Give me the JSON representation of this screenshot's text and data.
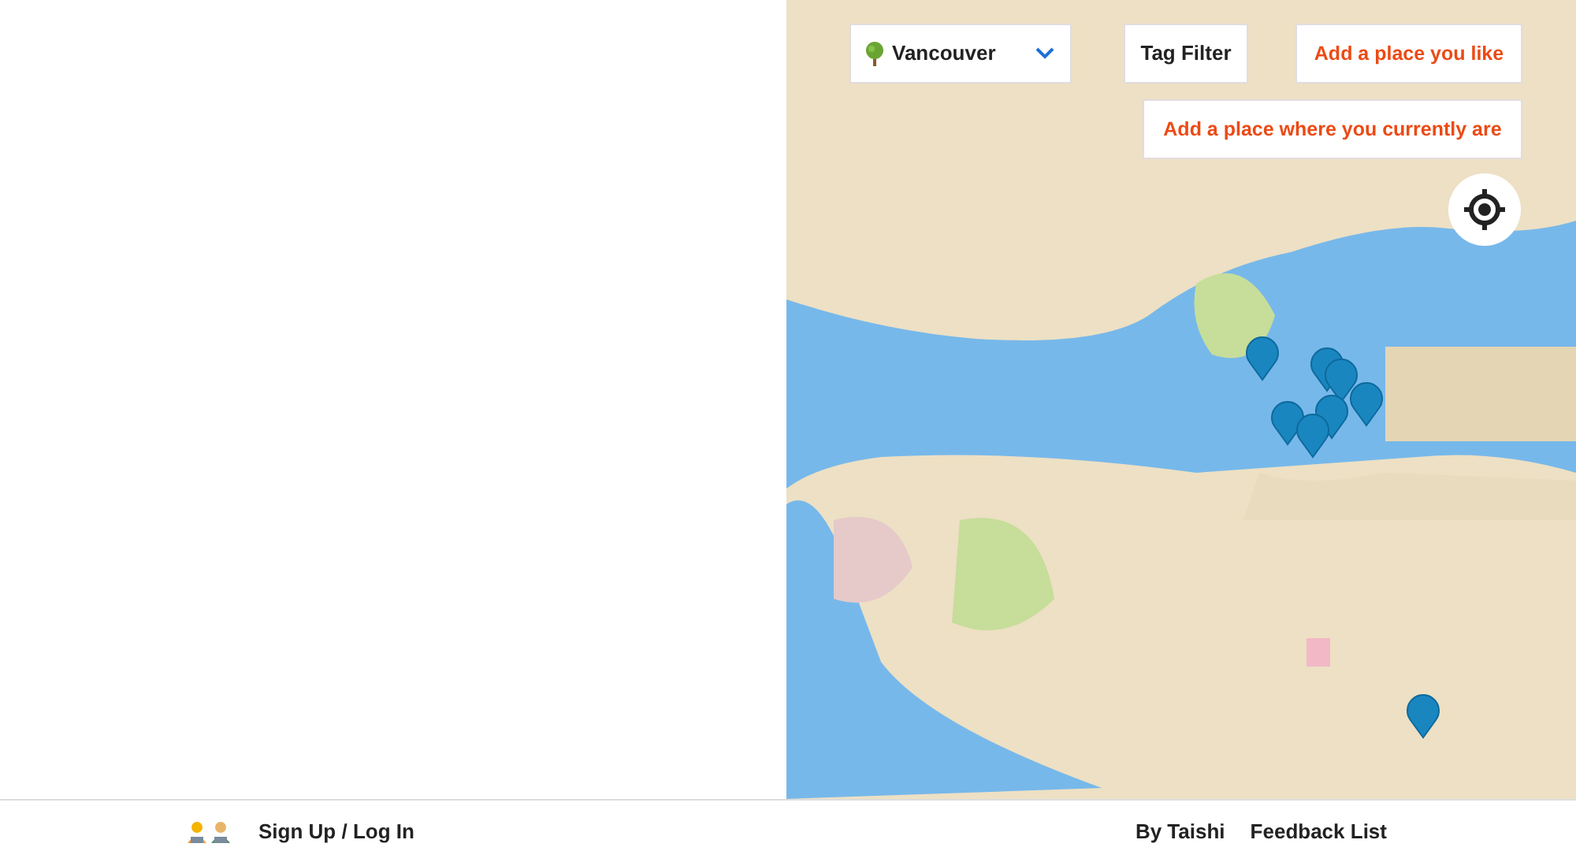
{
  "map_controls": {
    "city_select": {
      "value": "Vancouver"
    },
    "tag_filter": "Tag Filter",
    "add_liked_place": "Add a place you like",
    "add_current_place": "Add a place where you currently are"
  },
  "footer": {
    "sign_in": "Sign Up / Log In",
    "links": [
      "By Taishi",
      "Feedback List"
    ]
  }
}
